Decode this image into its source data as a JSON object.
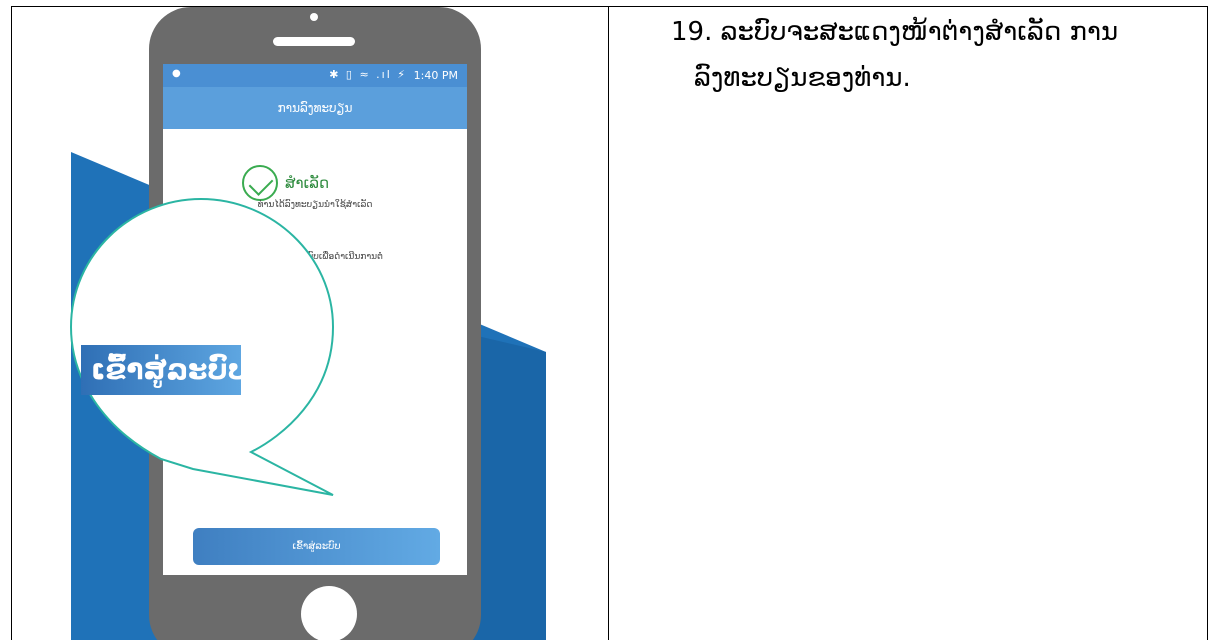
{
  "phone": {
    "status_time": "1:40 PM",
    "status_icons": "✱ ▯ ≈ .ıl ⚡",
    "app_bar_title": "ການລົງທະບຽນ",
    "success_title": "ສໍາເລັດ",
    "success_subtitle": "ທ່ານໄດ້ລົງທະບຽນນໍາໃຊ້ສໍາເລັດ",
    "instruction": "ກະລຸນາເຂົ້າສູ່ລະບົບເພື່ອດໍາເນີນການຕໍ່",
    "login_button": "ເຂົ້າສູ່ລະບົບ",
    "zoom_label": "ເຂົ້າສູ່ລະບົບ"
  },
  "caption": {
    "line1": "19. ລະບົບຈະສະແດງໜ້າຕ່າງສໍາເລັດ ການ",
    "line2": "ລົງທະບຽນຂອງທ່ານ."
  },
  "colors": {
    "background_blue": "#1f72b8",
    "phone_body": "#6b6b6b",
    "success_green": "#3aab50",
    "zoom_ring": "#2bb5a3"
  }
}
